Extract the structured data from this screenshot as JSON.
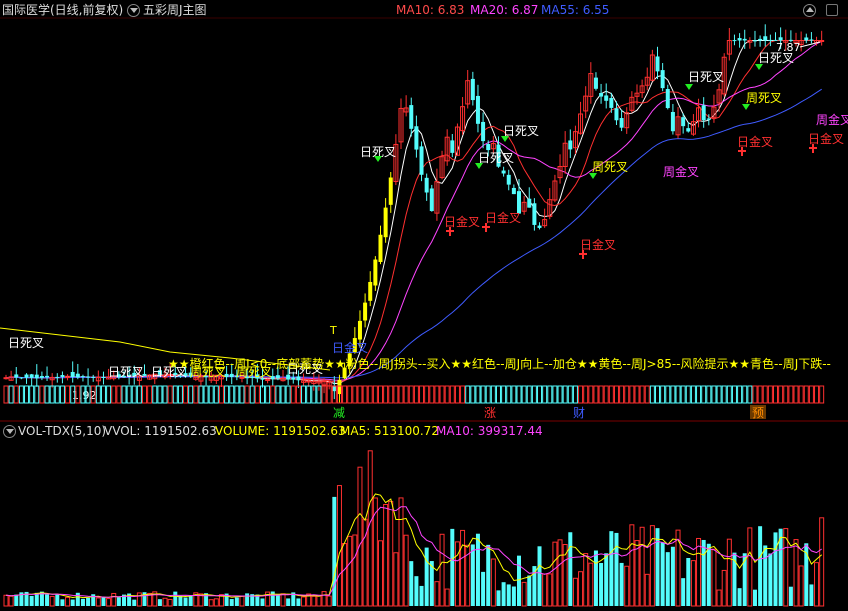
{
  "header": {
    "stock_name": "国际医学(日线,前复权)",
    "formula": "五彩周J主图",
    "ma": [
      {
        "label": "MA10: 6.83",
        "color": "#ff4a4a"
      },
      {
        "label": "MA20: 6.87",
        "color": "#ff44ff"
      },
      {
        "label": "MA55: 6.55",
        "color": "#3f5bff"
      }
    ]
  },
  "vol_header": {
    "name": "VOL-TDX(5,10)",
    "vvol": "VVOL: 1191502.63",
    "volume": "VOLUME: 1191502.63",
    "ma5": "MA5: 513100.72",
    "ma10": "MA10: 399317.44"
  },
  "colors": {
    "up": "#ff3030",
    "down": "#54fcfc",
    "yellow": "#ffff00",
    "white": "#ffffff",
    "magenta": "#ff44ff",
    "blue": "#3f5bff",
    "orange": "#ff8c00"
  },
  "chart_data": {
    "type": "candlestick",
    "price_max_label": "7.87",
    "price_min_label": "1.92",
    "candles_count": 160,
    "late_closes": [
      1.95,
      2.14,
      2.35,
      2.59,
      2.85,
      3.14,
      3.45,
      3.8,
      4.18,
      4.6,
      5.06,
      5.57,
      6.13,
      6.74
    ],
    "annotations": {
      "daily_death": "日死叉",
      "daily_golden": "日金叉",
      "weekly_death": "周死叉",
      "weekly_golden": "周金叉"
    },
    "legend_scroll": "★★橙红色--周J<0--底部蓄势★★粉色--周J拐头--买入★★红色--周J向上--加仓★★黄色--周J>85--风险提示★★青色--周J下跌--",
    "bar_labels": [
      "减",
      "涨",
      "财",
      "预"
    ],
    "note_T": "T"
  }
}
